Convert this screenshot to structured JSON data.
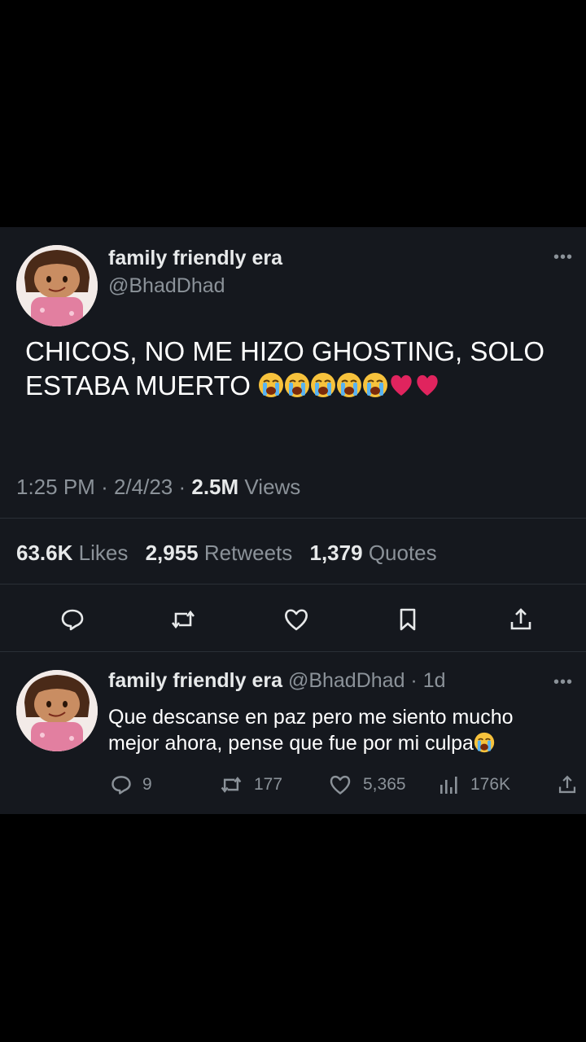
{
  "tweet": {
    "display_name": "family friendly era",
    "handle": "@BhadDhad",
    "more": "•••",
    "text": "CHICOS, NO ME HIZO GHOSTING, SOLO ESTABA MUERTO",
    "time": "1:25 PM",
    "date": "2/4/23",
    "views_count": "2.5M",
    "views_label": "Views",
    "likes_count": "63.6K",
    "likes_label": "Likes",
    "retweets_count": "2,955",
    "retweets_label": "Retweets",
    "quotes_count": "1,379",
    "quotes_label": "Quotes",
    "icons": [
      "reply-icon",
      "retweet-icon",
      "like-icon",
      "bookmark-icon",
      "share-icon"
    ]
  },
  "reply": {
    "display_name": "family friendly era",
    "handle": "@BhadDhad",
    "age": "· 1d",
    "more": "•••",
    "text": "Que descanse en paz pero me siento mucho mejor ahora, pense que fue por mi culpa",
    "reply_count": "9",
    "retweet_count": "177",
    "like_count": "5,365",
    "view_count": "176K"
  },
  "colors": {
    "background": "#000000",
    "card": "#15181e",
    "primary_text": "#e7e9ea",
    "secondary_text": "#8b9299",
    "heart": "#e0245e"
  }
}
